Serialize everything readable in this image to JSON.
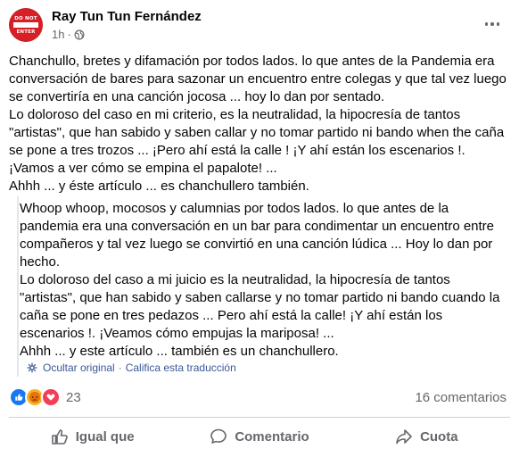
{
  "post": {
    "author": "Ray Tun Tun Fernández",
    "time": "1h",
    "dot": "·",
    "avatar_text_top": "DO NOT",
    "avatar_text_bottom": "ENTER",
    "text": "Chanchullo, bretes y difamación por todos lados. lo que antes de la Pandemia era conversación de bares para sazonar un encuentro entre colegas y que tal vez luego se convertiría en una canción jocosa ... hoy lo dan por sentado.\nLo doloroso del caso en mi criterio, es la neutralidad, la hipocresía de tantos \"artistas\", que han sabido y saben callar y no tomar partido ni bando when the caña se pone a tres trozos ... ¡Pero ahí está la calle ! ¡Y ahí están los escenarios !. ¡Vamos a ver cómo se empina el papalote! ...\nAhhh ... y éste artículo ... es chanchullero también.",
    "translation": "Whoop whoop, mocosos y calumnias por todos lados. lo que antes de la pandemia era una conversación en un bar para condimentar un encuentro entre compañeros y tal vez luego se convirtió en una canción lúdica ... Hoy lo dan por hecho.\nLo doloroso del caso a mi juicio es la neutralidad, la hipocresía de tantos \"artistas\", que han sabido y saben callarse y no tomar partido ni bando cuando la caña se pone en tres pedazos ... Pero ahí está la calle! ¡Y ahí están los escenarios !. ¡Veamos cómo empujas la mariposa! ...\nAhhh ... y este artículo ... también es un chanchullero.",
    "hide_original": "Ocultar original",
    "rate_translation": "Califica esta traducción",
    "translation_sep": "·",
    "reaction_count": "23",
    "comments": "16 comentarios",
    "actions": {
      "like": "Igual que",
      "comment": "Comentario",
      "share": "Cuota"
    },
    "colors": {
      "link": "#385898",
      "muted": "#65676b",
      "like_blue": "#1877f2",
      "love_red": "#f33e58",
      "angry_orange": "#f7b125"
    },
    "icons": {
      "globe": "globe-icon",
      "more": "more-options-icon",
      "gear": "gear-icon",
      "like": "thumbs-up-icon",
      "comment": "comment-bubble-icon",
      "share": "share-arrow-icon"
    }
  }
}
